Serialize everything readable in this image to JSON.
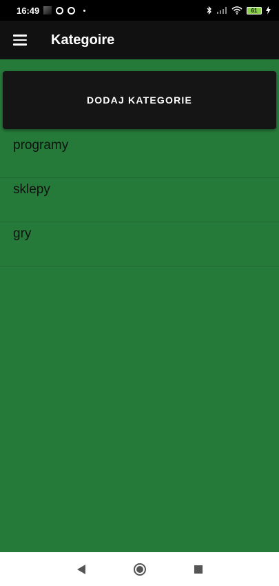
{
  "status_bar": {
    "time": "16:49",
    "battery_level": "61",
    "icons": [
      "notification-square-icon",
      "at-icon",
      "at-icon",
      "dot-icon",
      "bluetooth-icon",
      "signal-icon",
      "wifi-icon",
      "battery-icon",
      "charging-icon"
    ]
  },
  "app_bar": {
    "title": "Kategoire",
    "menu_icon": "hamburger-menu-icon"
  },
  "add_button": {
    "label": "DODAJ KATEGORIE"
  },
  "categories": [
    {
      "label": "programy"
    },
    {
      "label": "sklepy"
    },
    {
      "label": "gry"
    }
  ],
  "nav_bar": {
    "icons": [
      "back-icon",
      "home-icon",
      "recents-icon"
    ]
  },
  "colors": {
    "background": "#257a3a",
    "app_bar": "#111111",
    "button": "#151515",
    "text_on_dark": "#ffffff",
    "list_text": "#111111"
  }
}
